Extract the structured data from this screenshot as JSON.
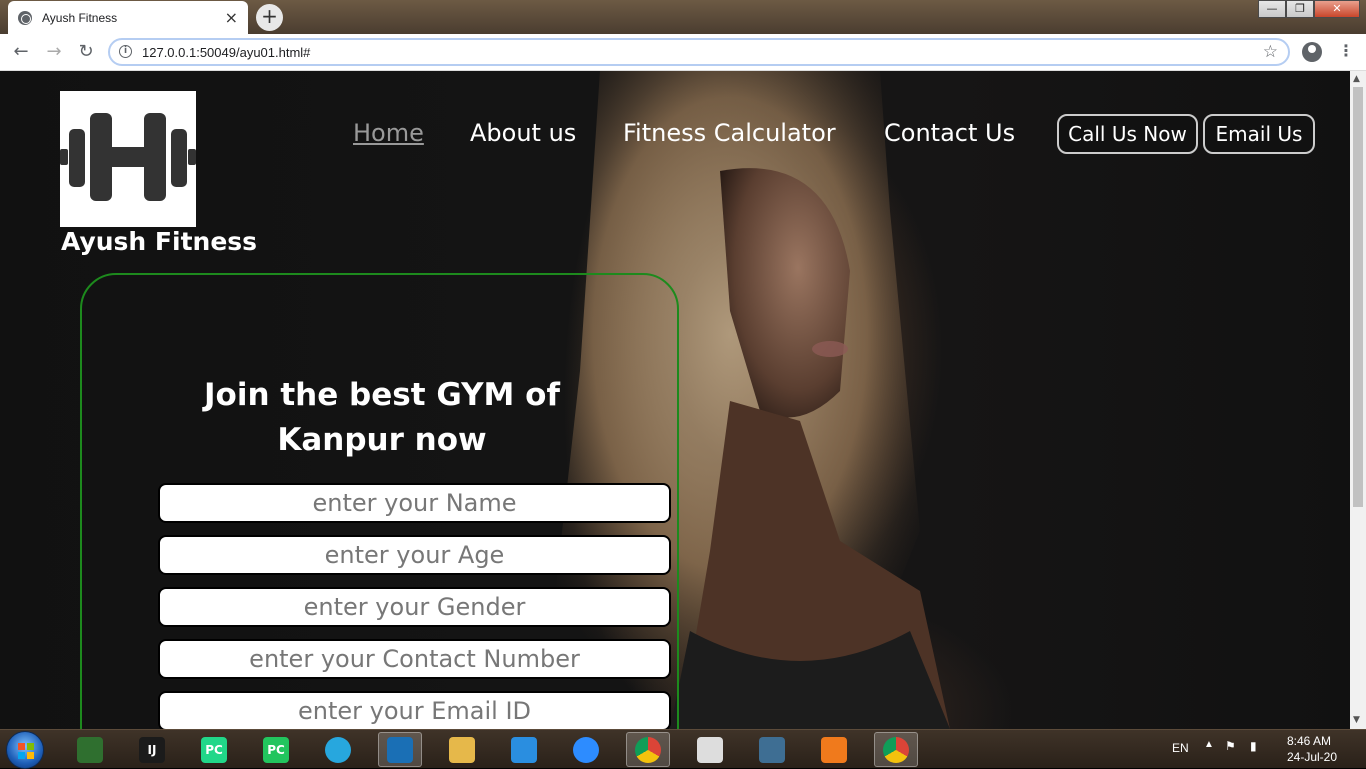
{
  "browser": {
    "tab_title": "Ayush Fitness",
    "tab_close": "×",
    "new_tab": "+",
    "back": "←",
    "forward": "→",
    "reload": "↻",
    "url": "127.0.0.1:50049/ayu01.html#",
    "star": "☆",
    "menu": "⋮",
    "win_min": "—",
    "win_max": "❐",
    "win_close": "✕"
  },
  "site": {
    "brand": "Ayush Fitness",
    "nav": {
      "home": "Home",
      "about": "About us",
      "calculator": "Fitness Calculator",
      "contact": "Contact Us"
    },
    "call_button": "Call Us Now",
    "email_button": "Email Us"
  },
  "form": {
    "title_line1": "Join the best GYM of",
    "title_line2": "Kanpur now",
    "name_placeholder": "enter your Name",
    "age_placeholder": "enter your Age",
    "gender_placeholder": "enter your Gender",
    "contact_placeholder": "enter your Contact Number",
    "email_placeholder": "enter your Email ID"
  },
  "taskbar": {
    "language": "EN",
    "time": "8:46 AM",
    "date": "24-Jul-20",
    "apps": [
      {
        "name": "file-manager",
        "label": "",
        "color": "#2f6f2f"
      },
      {
        "name": "intellij-idea",
        "label": "IJ",
        "color": "#1b1b1b"
      },
      {
        "name": "pycharm-pro",
        "label": "PC",
        "color": "#21d789"
      },
      {
        "name": "pycharm-community",
        "label": "PC",
        "color": "#22c55e"
      },
      {
        "name": "alexa",
        "label": "",
        "color": "#27a7de"
      },
      {
        "name": "brackets",
        "label": "",
        "color": "#1a6fb5"
      },
      {
        "name": "explorer-folder",
        "label": "",
        "color": "#e6b84a"
      },
      {
        "name": "vscode",
        "label": "",
        "color": "#2a8ee0"
      },
      {
        "name": "zoom",
        "label": "",
        "color": "#2d8cff"
      },
      {
        "name": "chrome",
        "label": "",
        "color": "#db4437"
      },
      {
        "name": "notepad",
        "label": "",
        "color": "#dddddd"
      },
      {
        "name": "mysql-workbench",
        "label": "",
        "color": "#3e6e93"
      },
      {
        "name": "xampp",
        "label": "",
        "color": "#f07a1c"
      },
      {
        "name": "chrome-active",
        "label": "",
        "color": "#db4437"
      }
    ]
  }
}
